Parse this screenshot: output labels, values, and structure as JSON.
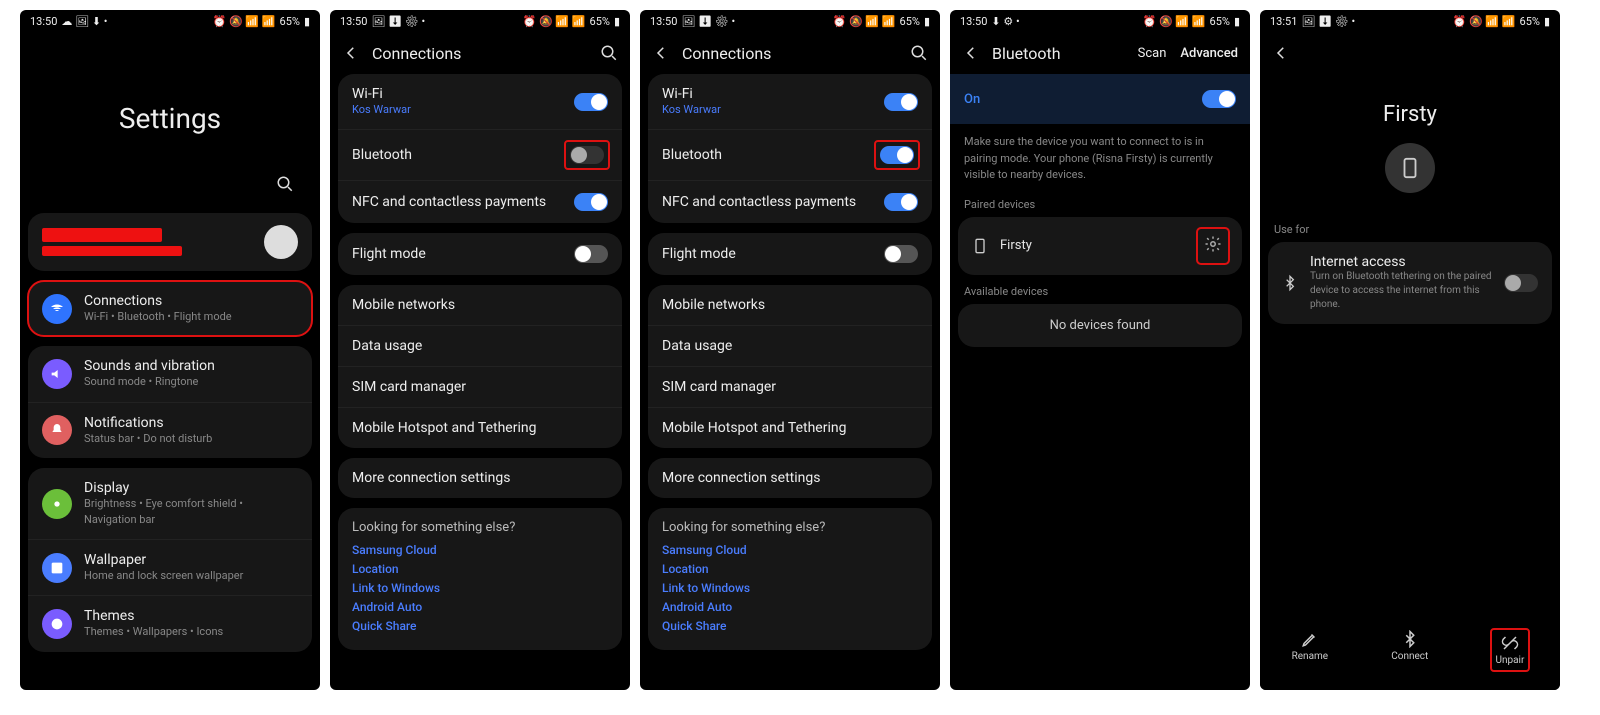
{
  "statusbar": {
    "time1": "13:50",
    "time2": "13:51",
    "battery": "65%"
  },
  "screen1": {
    "title": "Settings",
    "profile_email_redacted": "redacted@redacted",
    "items": [
      {
        "label": "Connections",
        "sub": "Wi-Fi  •  Bluetooth  •  Flight mode"
      },
      {
        "label": "Sounds and vibration",
        "sub": "Sound mode  •  Ringtone"
      },
      {
        "label": "Notifications",
        "sub": "Status bar  •  Do not disturb"
      },
      {
        "label": "Display",
        "sub": "Brightness  •  Eye comfort shield  •  Navigation bar"
      },
      {
        "label": "Wallpaper",
        "sub": "Home and lock screen wallpaper"
      },
      {
        "label": "Themes",
        "sub": "Themes  •  Wallpapers  •  Icons"
      }
    ]
  },
  "screen2": {
    "title": "Connections",
    "wifi": {
      "label": "Wi-Fi",
      "sub": "Kos Warwar",
      "on": true
    },
    "bluetooth": {
      "label": "Bluetooth",
      "on": false
    },
    "nfc": {
      "label": "NFC and contactless payments",
      "on": true
    },
    "flight": {
      "label": "Flight mode",
      "on": false
    },
    "group2": [
      "Mobile networks",
      "Data usage",
      "SIM card manager",
      "Mobile Hotspot and Tethering"
    ],
    "more": "More connection settings",
    "looking": {
      "hdr": "Looking for something else?",
      "links": [
        "Samsung Cloud",
        "Location",
        "Link to Windows",
        "Android Auto",
        "Quick Share"
      ]
    }
  },
  "screen3": {
    "title": "Connections",
    "wifi": {
      "label": "Wi-Fi",
      "sub": "Kos Warwar",
      "on": true
    },
    "bluetooth": {
      "label": "Bluetooth",
      "on": true
    },
    "nfc": {
      "label": "NFC and contactless payments",
      "on": true
    },
    "flight": {
      "label": "Flight mode",
      "on": false
    },
    "group2": [
      "Mobile networks",
      "Data usage",
      "SIM card manager",
      "Mobile Hotspot and Tethering"
    ],
    "more": "More connection settings",
    "looking": {
      "hdr": "Looking for something else?",
      "links": [
        "Samsung Cloud",
        "Location",
        "Link to Windows",
        "Android Auto",
        "Quick Share"
      ]
    }
  },
  "screen4": {
    "title": "Bluetooth",
    "scan": "Scan",
    "advanced": "Advanced",
    "on_label": "On",
    "help": "Make sure the device you want to connect to is in pairing mode. Your phone (Risna Firsty) is currently visible to nearby devices.",
    "paired_hdr": "Paired devices",
    "paired_device": "Firsty",
    "avail_hdr": "Available devices",
    "nodev": "No devices found"
  },
  "screen5": {
    "device_name": "Firsty",
    "usefor": "Use for",
    "internet": {
      "label": "Internet access",
      "sub": "Turn on Bluetooth tethering on the paired device to access the internet from this phone."
    },
    "actions": {
      "rename": "Rename",
      "connect": "Connect",
      "unpair": "Unpair"
    }
  }
}
